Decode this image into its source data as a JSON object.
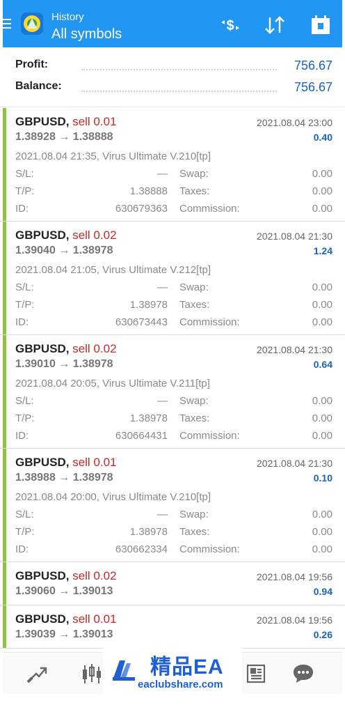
{
  "header": {
    "title": "History",
    "subtitle": "All symbols",
    "accent_color": "#2196f3",
    "icons": [
      "menu-icon",
      "app-logo-icon",
      "currency-filter-icon",
      "sort-icon",
      "calendar-icon"
    ]
  },
  "summary": {
    "profit_label": "Profit:",
    "profit_value": "756.67",
    "balance_label": "Balance:",
    "balance_value": "756.67"
  },
  "deals": [
    {
      "symbol": "GBPUSD,",
      "type": "sell 0.01",
      "prices": "1.38928 → 1.38888",
      "time": "2021.08.04 23:00",
      "profit": "0.40",
      "comment": "2021.08.04 21:35, Virus Ultimate V.210[tp]",
      "sl_label": "S/L:",
      "sl": "—",
      "swap_label": "Swap:",
      "swap": "0.00",
      "tp_label": "T/P:",
      "tp": "1.38888",
      "taxes_label": "Taxes:",
      "taxes": "0.00",
      "id_label": "ID:",
      "id": "630679363",
      "commission_label": "Commission:",
      "commission": "0.00"
    },
    {
      "symbol": "GBPUSD,",
      "type": "sell 0.02",
      "prices": "1.39040 → 1.38978",
      "time": "2021.08.04 21:30",
      "profit": "1.24",
      "comment": "2021.08.04 21:05, Virus Ultimate V.212[tp]",
      "sl_label": "S/L:",
      "sl": "—",
      "swap_label": "Swap:",
      "swap": "0.00",
      "tp_label": "T/P:",
      "tp": "1.38978",
      "taxes_label": "Taxes:",
      "taxes": "0.00",
      "id_label": "ID:",
      "id": "630673443",
      "commission_label": "Commission:",
      "commission": "0.00"
    },
    {
      "symbol": "GBPUSD,",
      "type": "sell 0.02",
      "prices": "1.39010 → 1.38978",
      "time": "2021.08.04 21:30",
      "profit": "0.64",
      "comment": "2021.08.04 20:05, Virus Ultimate V.211[tp]",
      "sl_label": "S/L:",
      "sl": "—",
      "swap_label": "Swap:",
      "swap": "0.00",
      "tp_label": "T/P:",
      "tp": "1.38978",
      "taxes_label": "Taxes:",
      "taxes": "0.00",
      "id_label": "ID:",
      "id": "630664431",
      "commission_label": "Commission:",
      "commission": "0.00"
    },
    {
      "symbol": "GBPUSD,",
      "type": "sell 0.01",
      "prices": "1.38988 → 1.38978",
      "time": "2021.08.04 21:30",
      "profit": "0.10",
      "comment": "2021.08.04 20:00, Virus Ultimate V.210[tp]",
      "sl_label": "S/L:",
      "sl": "—",
      "swap_label": "Swap:",
      "swap": "0.00",
      "tp_label": "T/P:",
      "tp": "1.38978",
      "taxes_label": "Taxes:",
      "taxes": "0.00",
      "id_label": "ID:",
      "id": "630662334",
      "commission_label": "Commission:",
      "commission": "0.00"
    },
    {
      "symbol": "GBPUSD,",
      "type": "sell 0.02",
      "prices": "1.39060 → 1.39013",
      "time": "2021.08.04 19:56",
      "profit": "0.94"
    },
    {
      "symbol": "GBPUSD,",
      "type": "sell 0.01",
      "prices": "1.39039 → 1.39013",
      "time": "2021.08.04 19:56",
      "profit": "0.26"
    }
  ],
  "bottom_nav": {
    "icons": [
      "trade-icon",
      "chart-icon",
      "news-icon",
      "chat-icon"
    ]
  },
  "watermark": {
    "title": "精品EA",
    "url": "eaclubshare.com"
  },
  "colors": {
    "profit_blue": "#1565c0",
    "sell_red": "#c62828",
    "deal_bar_green": "#8cc63f"
  }
}
